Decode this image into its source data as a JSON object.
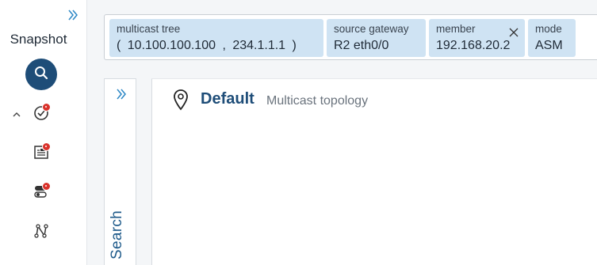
{
  "sidebar": {
    "title": "Snapshot",
    "items": [
      {
        "icon": "search-icon",
        "badge": false
      },
      {
        "icon": "check-circle-icon",
        "badge": true
      },
      {
        "icon": "report-icon",
        "badge": true
      },
      {
        "icon": "toggle-icon",
        "badge": true
      },
      {
        "icon": "path-icon",
        "badge": false
      }
    ]
  },
  "filters": [
    {
      "label": "multicast tree",
      "value": "( 10.100.100.100 , 234.1.1.1 )",
      "closable": false
    },
    {
      "label": "source gateway",
      "value": "R2 eth0/0",
      "closable": false
    },
    {
      "label": "member",
      "value": "192.168.20.2",
      "closable": true
    },
    {
      "label": "mode",
      "value": "ASM",
      "closable": false
    }
  ],
  "search_tab": {
    "label": "Search"
  },
  "main": {
    "title": "Default",
    "subtitle": "Multicast topology"
  },
  "colors": {
    "accent": "#1e4d78",
    "chip_bg": "#cfe3f3",
    "badge": "#d9322b"
  }
}
